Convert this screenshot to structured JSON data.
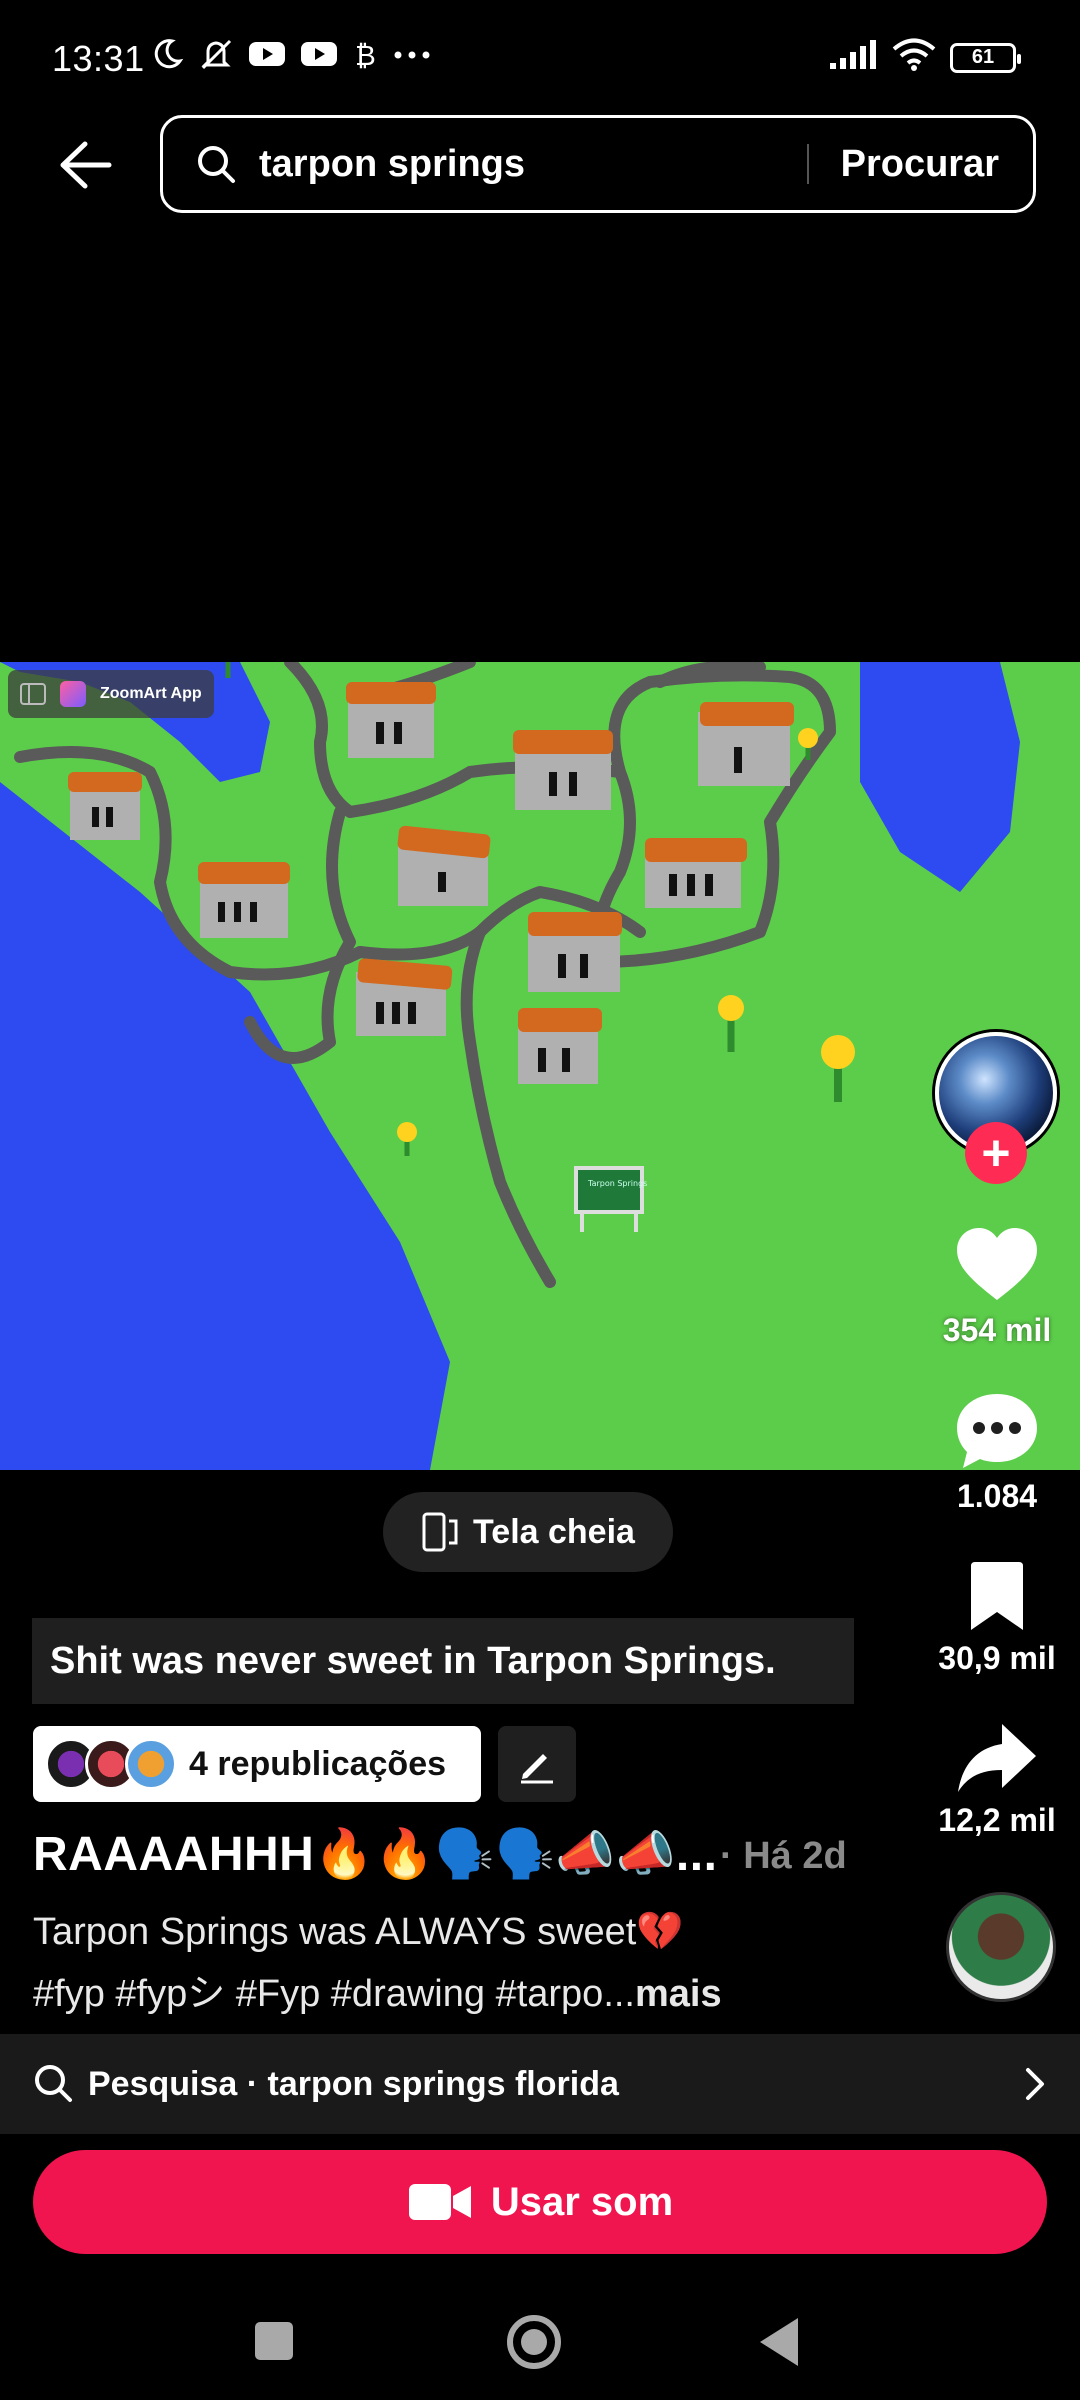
{
  "status_bar": {
    "time": "13:31",
    "battery": "61",
    "icons_left": [
      "moon-icon",
      "mute-icon",
      "youtube-icon",
      "youtube-icon",
      "bitcoin-icon",
      "more-icon"
    ],
    "icons_right": [
      "signal-icon",
      "wifi-icon",
      "battery-icon"
    ]
  },
  "search": {
    "query": "tarpon springs",
    "submit_label": "Procurar"
  },
  "video": {
    "watermark": "ZoomArt App",
    "sign_text": "Tarpon Springs"
  },
  "rail": {
    "likes": "354 mil",
    "comments": "1.084",
    "saves": "30,9 mil",
    "shares": "12,2 mil",
    "follow_symbol": "+"
  },
  "fullscreen_label": "Tela cheia",
  "caption": "Shit was never sweet in Tarpon Springs.",
  "reposts_label": "4 republicações",
  "title": "RAAAAHHH🔥🔥🗣️🗣️📣📣...",
  "posted": "· Há 2d",
  "description": {
    "line1": "Tarpon Springs was ALWAYS sweet💔",
    "tags": "#fyp #fypシ #Fyp #drawing #tarpo...",
    "more": "mais"
  },
  "suggestion": {
    "label": "Pesquisa · tarpon springs florida"
  },
  "use_sound_label": "Usar som",
  "colors": {
    "accent": "#fe2c55",
    "use_sound": "#f0144f",
    "grass": "#5ccd4a",
    "water": "#2d4bf0",
    "road": "#5a5a5a",
    "roof": "#d2691e"
  }
}
